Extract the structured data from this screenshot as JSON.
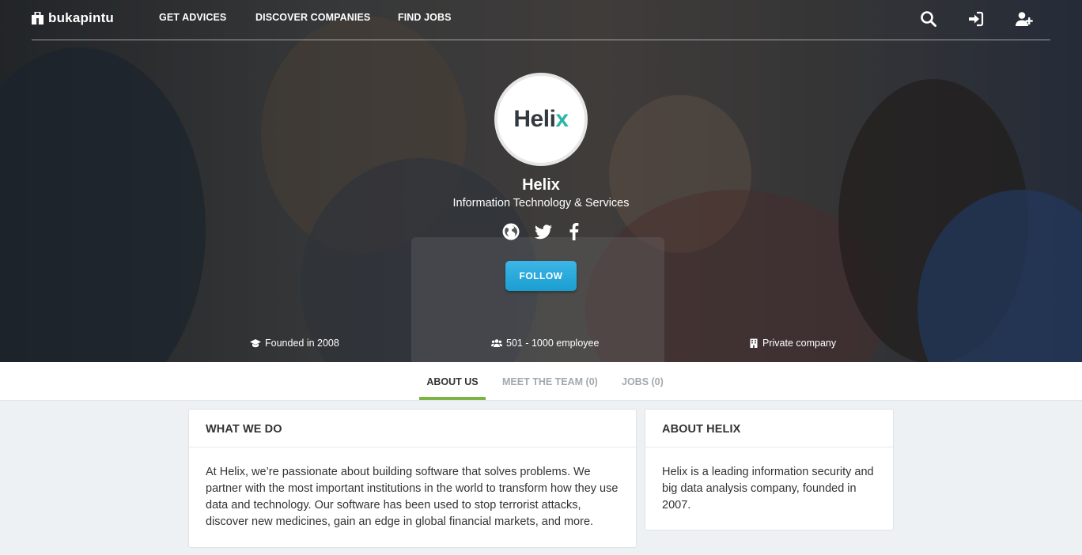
{
  "brand": {
    "name": "bukapintu"
  },
  "nav": {
    "links": [
      "GET ADVICES",
      "DISCOVER COMPANIES",
      "FIND JOBS"
    ],
    "icons": [
      "search-icon",
      "sign-in-icon",
      "user-plus-icon"
    ]
  },
  "company": {
    "logo_text": "Heli",
    "logo_accent": "x",
    "name": "Helix",
    "industry": "Information Technology & Services",
    "social": [
      "globe-icon",
      "twitter-icon",
      "facebook-icon"
    ],
    "follow_label": "FOLLOW",
    "facts": {
      "founded": "Founded in 2008",
      "employees": "501 - 1000 employee",
      "type": "Private company"
    }
  },
  "tabs": [
    {
      "label": "ABOUT US",
      "active": true
    },
    {
      "label": "MEET THE TEAM (0)",
      "active": false
    },
    {
      "label": "JOBS (0)",
      "active": false
    }
  ],
  "what_we_do": {
    "title": "WHAT WE DO",
    "text": "At Helix, we’re passionate about building software that solves problems. We partner with the most important institutions in the world to transform how they use data and technology. Our software has been used to stop terrorist attacks, discover new medicines, gain an edge in global financial markets, and more."
  },
  "about": {
    "title": "ABOUT HELIX",
    "text": "Helix is a leading information security and big data analysis company, founded in 2007."
  },
  "colors": {
    "accent_green": "#7cb342",
    "follow_blue": "#1a9ed0",
    "logo_accent": "#2cb5a6"
  }
}
